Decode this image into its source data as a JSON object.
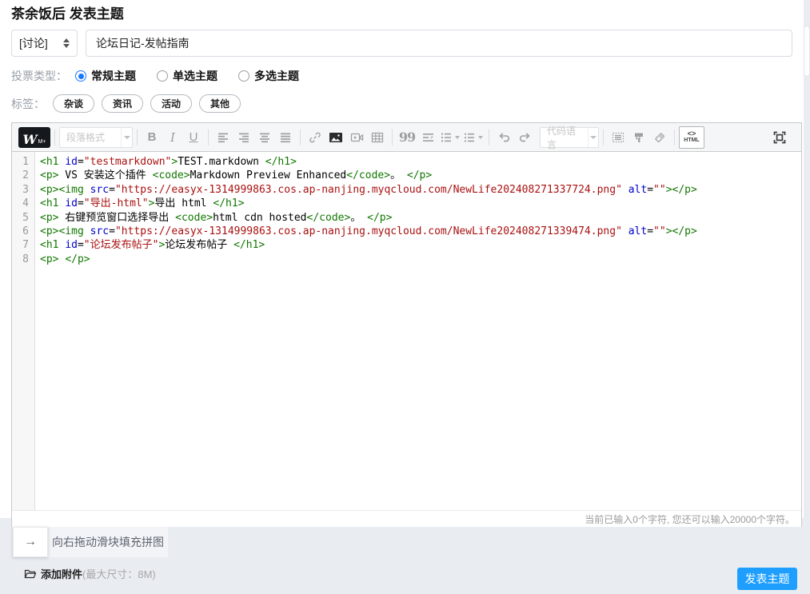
{
  "page": {
    "title": "茶余饭后 发表主题"
  },
  "form": {
    "category": {
      "value": "[讨论]"
    },
    "title_input": {
      "value": "论坛日记-发帖指南"
    },
    "poll": {
      "label": "投票类型：",
      "options": [
        {
          "label": "常规主题",
          "selected": true
        },
        {
          "label": "单选主题",
          "selected": false
        },
        {
          "label": "多选主题",
          "selected": false
        }
      ]
    },
    "tags": {
      "label": "标签：",
      "items": [
        "杂谈",
        "资讯",
        "活动",
        "其他"
      ]
    }
  },
  "editor": {
    "toolbar": {
      "logo_main": "W",
      "logo_sub": "M+",
      "paragraph_placeholder": "段落格式",
      "bold": "B",
      "italic": "I",
      "underline": "U",
      "quote_glyph": "99",
      "code_lang_placeholder": "代码语言",
      "html_symbol": "<>",
      "html_label": "HTML",
      "icons": [
        "wang-logo",
        "paragraph-format-select",
        "bold",
        "italic",
        "underline",
        "align-left",
        "align-right",
        "align-center",
        "align-justify",
        "link",
        "image",
        "video",
        "table",
        "quote",
        "indent",
        "ordered-list",
        "unordered-list",
        "undo",
        "redo",
        "code-language-select",
        "code-block",
        "format-painter",
        "eraser",
        "html-source",
        "fullscreen"
      ]
    },
    "syntax_colors": {
      "tag": "#117700",
      "attribute": "#0000cc",
      "string": "#aa1111",
      "text": "#000000"
    },
    "code_lines": [
      {
        "segs": [
          [
            "tag",
            "<h1"
          ],
          [
            "txt",
            " "
          ],
          [
            "attr",
            "id"
          ],
          [
            "txt",
            "="
          ],
          [
            "str",
            "\"testmarkdown\""
          ],
          [
            "tag",
            ">"
          ],
          [
            "txt",
            "TEST.markdown "
          ],
          [
            "tag",
            "</h1>"
          ]
        ]
      },
      {
        "segs": [
          [
            "tag",
            "<p>"
          ],
          [
            "txt",
            " VS 安装这个插件 "
          ],
          [
            "tag",
            "<code>"
          ],
          [
            "txt",
            "Markdown Preview Enhanced"
          ],
          [
            "tag",
            "</code>"
          ],
          [
            "txt",
            "。 "
          ],
          [
            "tag",
            "</p>"
          ]
        ]
      },
      {
        "segs": [
          [
            "tag",
            "<p>"
          ],
          [
            "tag",
            "<img"
          ],
          [
            "txt",
            " "
          ],
          [
            "attr",
            "src"
          ],
          [
            "txt",
            "="
          ],
          [
            "str",
            "\"https://easyx-1314999863.cos.ap-nanjing.myqcloud.com/NewLife202408271337724.png\""
          ],
          [
            "txt",
            " "
          ],
          [
            "attr",
            "alt"
          ],
          [
            "txt",
            "="
          ],
          [
            "str",
            "\"\""
          ],
          [
            "tag",
            ">"
          ],
          [
            "tag",
            "</p>"
          ]
        ]
      },
      {
        "segs": [
          [
            "tag",
            "<h1"
          ],
          [
            "txt",
            " "
          ],
          [
            "attr",
            "id"
          ],
          [
            "txt",
            "="
          ],
          [
            "str",
            "\"导出-html\""
          ],
          [
            "tag",
            ">"
          ],
          [
            "txt",
            "导出 html "
          ],
          [
            "tag",
            "</h1>"
          ]
        ]
      },
      {
        "segs": [
          [
            "tag",
            "<p>"
          ],
          [
            "txt",
            " 右键预览窗口选择导出 "
          ],
          [
            "tag",
            "<code>"
          ],
          [
            "txt",
            "html cdn hosted"
          ],
          [
            "tag",
            "</code>"
          ],
          [
            "txt",
            "。 "
          ],
          [
            "tag",
            "</p>"
          ]
        ]
      },
      {
        "segs": [
          [
            "tag",
            "<p>"
          ],
          [
            "tag",
            "<img"
          ],
          [
            "txt",
            " "
          ],
          [
            "attr",
            "src"
          ],
          [
            "txt",
            "="
          ],
          [
            "str",
            "\"https://easyx-1314999863.cos.ap-nanjing.myqcloud.com/NewLife202408271339474.png\""
          ],
          [
            "txt",
            " "
          ],
          [
            "attr",
            "alt"
          ],
          [
            "txt",
            "="
          ],
          [
            "str",
            "\"\""
          ],
          [
            "tag",
            ">"
          ],
          [
            "tag",
            "</p>"
          ]
        ]
      },
      {
        "segs": [
          [
            "tag",
            "<h1"
          ],
          [
            "txt",
            " "
          ],
          [
            "attr",
            "id"
          ],
          [
            "txt",
            "="
          ],
          [
            "str",
            "\"论坛发布帖子\""
          ],
          [
            "tag",
            ">"
          ],
          [
            "txt",
            "论坛发布帖子 "
          ],
          [
            "tag",
            "</h1>"
          ]
        ]
      },
      {
        "segs": [
          [
            "tag",
            "<p>"
          ],
          [
            "txt",
            " "
          ],
          [
            "tag",
            "</p>"
          ]
        ]
      }
    ],
    "footer_text": "当前已输入0个字符, 您还可以输入20000个字符。"
  },
  "captcha": {
    "handle_arrow": "→",
    "prompt": "向右拖动滑块填充拼图"
  },
  "attachment": {
    "label": "添加附件",
    "hint": "(最大尺寸：8M)"
  },
  "actions": {
    "submit": "发表主题"
  },
  "colors": {
    "submit_bg": "#1E9FFF",
    "radio_active": "#1677ff",
    "page_bg": "#e9edf2"
  }
}
